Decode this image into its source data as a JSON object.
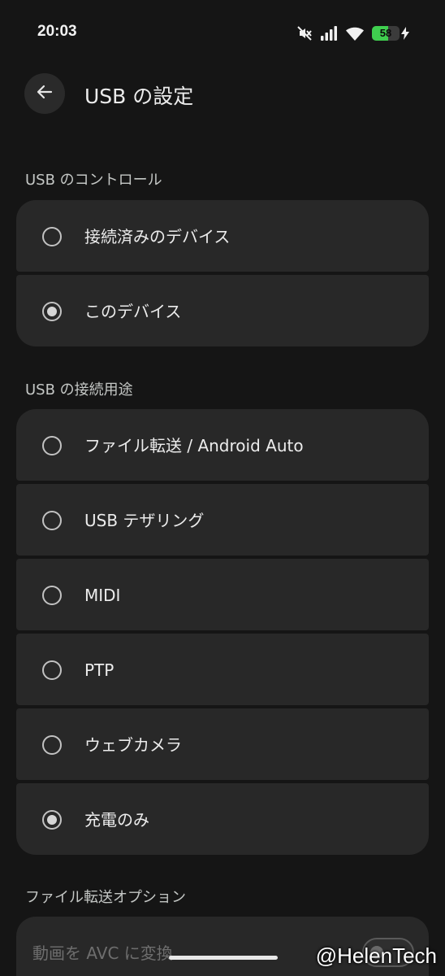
{
  "status_bar": {
    "time": "20:03",
    "battery_percent": 58,
    "battery_text": "58",
    "icons": [
      "mute-icon",
      "signal-icon",
      "wifi-icon",
      "battery-icon",
      "charging-bolt-icon"
    ],
    "battery_color": "#3fcf4f"
  },
  "header": {
    "title": "USB の設定",
    "back_icon": "back-arrow-icon"
  },
  "usb_control": {
    "header": "USB のコントロール",
    "options": [
      {
        "label": "接続済みのデバイス",
        "selected": false
      },
      {
        "label": "このデバイス",
        "selected": true
      }
    ]
  },
  "usb_mode": {
    "header": "USB の接続用途",
    "options": [
      {
        "label": "ファイル転送 / Android Auto",
        "selected": false
      },
      {
        "label": "USB テザリング",
        "selected": false
      },
      {
        "label": "MIDI",
        "selected": false
      },
      {
        "label": "PTP",
        "selected": false
      },
      {
        "label": "ウェブカメラ",
        "selected": false
      },
      {
        "label": "充電のみ",
        "selected": true
      }
    ]
  },
  "file_transfer_options": {
    "header": "ファイル転送オプション",
    "items": [
      {
        "label": "動画を AVC に変換",
        "enabled": false,
        "toggle_on": false
      }
    ]
  },
  "watermark": "@HelenTech",
  "colors": {
    "background": "#151515",
    "card": "#282828",
    "text": "#ececec"
  }
}
